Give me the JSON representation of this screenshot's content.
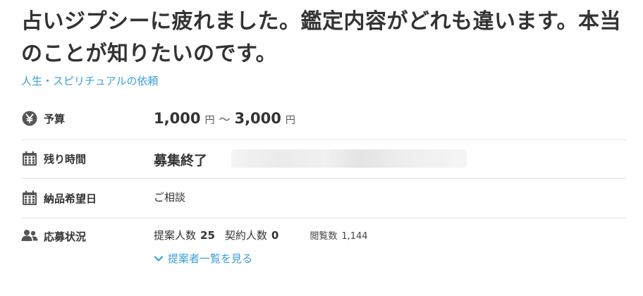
{
  "job": {
    "title": "占いジプシーに疲れました。鑑定内容がどれも違います。本当のことが知りたいのです。",
    "category": "人生・スピリチュアルの依頼"
  },
  "details": {
    "budget": {
      "label": "予算",
      "icon": "yen-icon",
      "min": "1,000",
      "max": "3,000",
      "unit": "円",
      "separator": "～"
    },
    "deadline": {
      "label": "残り時間",
      "icon": "calendar-icon",
      "value": "募集終了"
    },
    "delivery": {
      "label": "納品希望日",
      "icon": "calendar-icon",
      "value": "ご相談"
    },
    "applications": {
      "label": "応募状況",
      "icon": "people-icon",
      "proposals_label": "提案人数",
      "proposals": "25",
      "contracts_label": "契約人数",
      "contracts": "0",
      "views_label": "閲覧数",
      "views": "1,144",
      "view_link": "提案者一覧を見る"
    }
  },
  "colors": {
    "link": "#3a9fd8",
    "text": "#333333",
    "icon": "#555555",
    "divider": "#e6e6e6"
  }
}
